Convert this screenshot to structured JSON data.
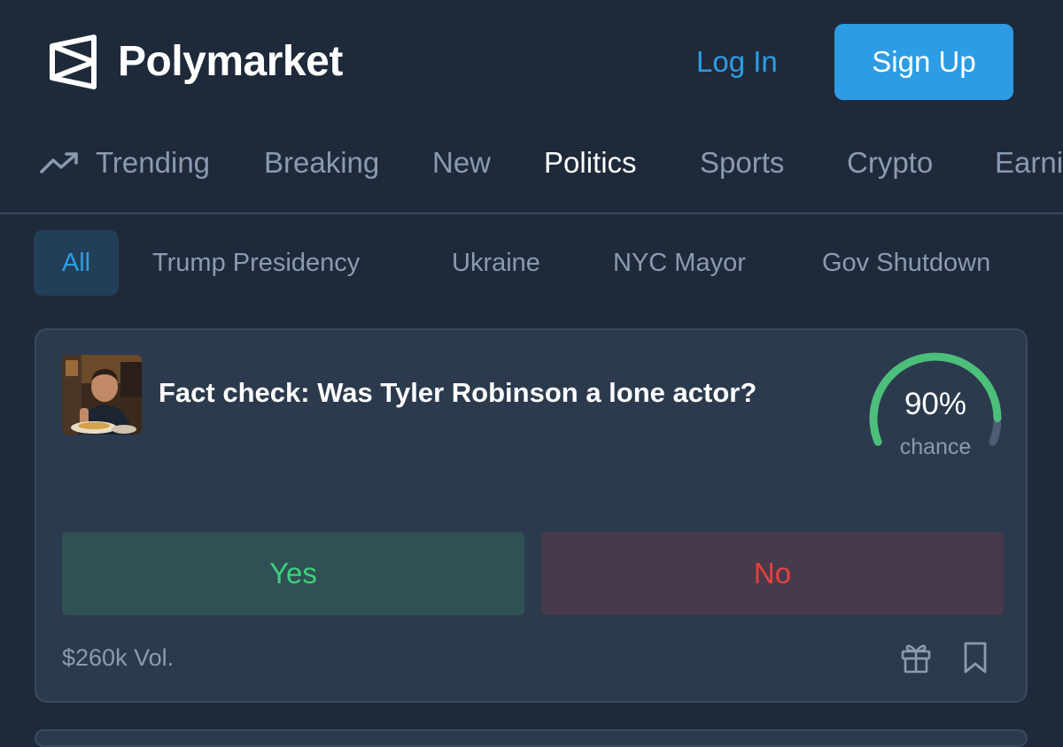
{
  "header": {
    "brand": "Polymarket",
    "logo_icon": "polymarket-logo-icon",
    "login_label": "Log In",
    "signup_label": "Sign Up",
    "accent_color": "#2e9ce4"
  },
  "nav": {
    "trend_icon": "trending-up-icon",
    "items": [
      {
        "label": "Trending",
        "active": false
      },
      {
        "label": "Breaking",
        "active": false
      },
      {
        "label": "New",
        "active": false
      },
      {
        "label": "Politics",
        "active": true
      },
      {
        "label": "Sports",
        "active": false
      },
      {
        "label": "Crypto",
        "active": false
      },
      {
        "label": "Earni",
        "active": false
      }
    ]
  },
  "tags": {
    "items": [
      {
        "label": "All",
        "active": true
      },
      {
        "label": "Trump Presidency",
        "active": false
      },
      {
        "label": "Ukraine",
        "active": false
      },
      {
        "label": "NYC Mayor",
        "active": false
      },
      {
        "label": "Gov Shutdown",
        "active": false
      }
    ]
  },
  "market": {
    "question": "Fact check: Was Tyler Robinson a lone actor?",
    "chance_value": "90%",
    "chance_fraction": 0.9,
    "chance_label": "chance",
    "yes_label": "Yes",
    "no_label": "No",
    "volume": "$260k Vol.",
    "gift_icon": "gift-icon",
    "bookmark_icon": "bookmark-icon",
    "colors": {
      "yes": "#3fd07f",
      "no": "#e8413e",
      "gauge": "#4cbf7a",
      "gauge_track": "#4d5e74"
    }
  }
}
